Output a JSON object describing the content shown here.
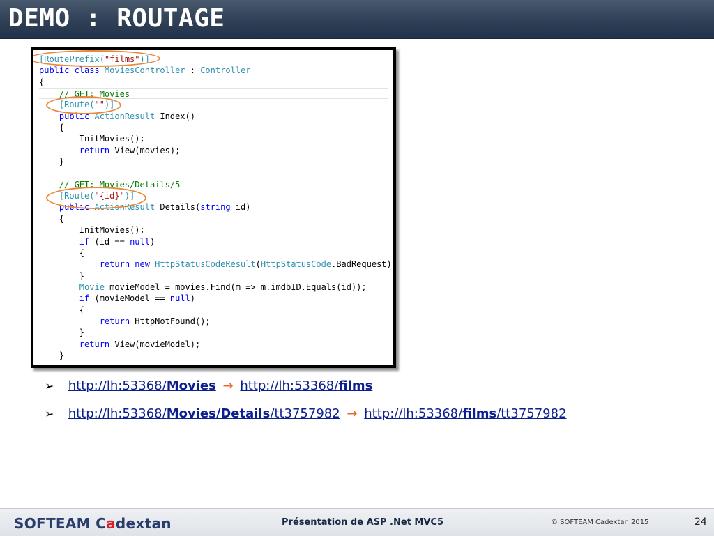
{
  "slide": {
    "title": "DEMO : ROUTAGE"
  },
  "code": {
    "lines": [
      [
        {
          "t": "[RoutePrefix(",
          "c": "ty"
        },
        {
          "t": "\"films\"",
          "c": "str"
        },
        {
          "t": ")]",
          "c": "ty"
        }
      ],
      [
        {
          "t": "public class ",
          "c": "kw"
        },
        {
          "t": "MoviesController",
          "c": "ty"
        },
        {
          "t": " : ",
          "c": ""
        },
        {
          "t": "Controller",
          "c": "ty"
        }
      ],
      [
        {
          "t": "{",
          "c": ""
        }
      ],
      [
        {
          "t": "    // GET: Movies",
          "c": "cm"
        }
      ],
      [
        {
          "t": "    [Route(",
          "c": "ty"
        },
        {
          "t": "\"\"",
          "c": "str"
        },
        {
          "t": ")]",
          "c": "ty"
        }
      ],
      [
        {
          "t": "    public ",
          "c": "kw"
        },
        {
          "t": "ActionResult",
          "c": "ty"
        },
        {
          "t": " Index()",
          "c": ""
        }
      ],
      [
        {
          "t": "    {",
          "c": ""
        }
      ],
      [
        {
          "t": "        InitMovies();",
          "c": ""
        }
      ],
      [
        {
          "t": "        return ",
          "c": "kw"
        },
        {
          "t": "View(movies);",
          "c": ""
        }
      ],
      [
        {
          "t": "    }",
          "c": ""
        }
      ],
      [
        {
          "t": "",
          "c": ""
        }
      ],
      [
        {
          "t": "    // GET: Movies/Details/5",
          "c": "cm"
        }
      ],
      [
        {
          "t": "    [Route(",
          "c": "ty"
        },
        {
          "t": "\"{id}\"",
          "c": "str"
        },
        {
          "t": ")]",
          "c": "ty"
        }
      ],
      [
        {
          "t": "    public ",
          "c": "kw"
        },
        {
          "t": "ActionResult",
          "c": "ty"
        },
        {
          "t": " Details(",
          "c": ""
        },
        {
          "t": "string",
          "c": "kw"
        },
        {
          "t": " id)",
          "c": ""
        }
      ],
      [
        {
          "t": "    {",
          "c": ""
        }
      ],
      [
        {
          "t": "        InitMovies();",
          "c": ""
        }
      ],
      [
        {
          "t": "        if ",
          "c": "kw"
        },
        {
          "t": "(id == ",
          "c": ""
        },
        {
          "t": "null",
          "c": "kw"
        },
        {
          "t": ")",
          "c": ""
        }
      ],
      [
        {
          "t": "        {",
          "c": ""
        }
      ],
      [
        {
          "t": "            return new ",
          "c": "kw"
        },
        {
          "t": "HttpStatusCodeResult",
          "c": "ty"
        },
        {
          "t": "(",
          "c": ""
        },
        {
          "t": "HttpStatusCode",
          "c": "ty"
        },
        {
          "t": ".BadRequest);",
          "c": ""
        }
      ],
      [
        {
          "t": "        }",
          "c": ""
        }
      ],
      [
        {
          "t": "        Movie",
          "c": "ty"
        },
        {
          "t": " movieModel = movies.Find(m => m.imdbID.Equals(id));",
          "c": ""
        }
      ],
      [
        {
          "t": "        if ",
          "c": "kw"
        },
        {
          "t": "(movieModel == ",
          "c": ""
        },
        {
          "t": "null",
          "c": "kw"
        },
        {
          "t": ")",
          "c": ""
        }
      ],
      [
        {
          "t": "        {",
          "c": ""
        }
      ],
      [
        {
          "t": "            return ",
          "c": "kw"
        },
        {
          "t": "HttpNotFound();",
          "c": ""
        }
      ],
      [
        {
          "t": "        }",
          "c": ""
        }
      ],
      [
        {
          "t": "        return ",
          "c": "kw"
        },
        {
          "t": "View(movieModel);",
          "c": ""
        }
      ],
      [
        {
          "t": "    }",
          "c": ""
        }
      ]
    ]
  },
  "bullets": [
    {
      "marker": "➢",
      "from_base": "http://lh:53368/",
      "from_bold": "Movies",
      "from_rest": "",
      "arrow": "→",
      "to_base": "http://lh:53368/",
      "to_bold": "films",
      "to_rest": ""
    },
    {
      "marker": "➢",
      "from_base": "http://lh:53368/",
      "from_bold": "Movies/Details",
      "from_rest": "/tt3757982",
      "arrow": "→",
      "to_base": "http://lh:53368/",
      "to_bold": "films",
      "to_rest": "/tt3757982"
    }
  ],
  "footer": {
    "brand_left": "SOFTEAM C",
    "brand_accent": "a",
    "brand_right": "dextan",
    "center": "Présentation de ASP .Net MVC5",
    "copyright": "© SOFTEAM Cadextan 2015",
    "page": "24"
  },
  "colors": {
    "title_bar": "#34445a",
    "highlight_ring": "#e8883a",
    "arrow": "#e0712b",
    "link": "#0b1f8f",
    "brand_accent": "#d8232a"
  }
}
